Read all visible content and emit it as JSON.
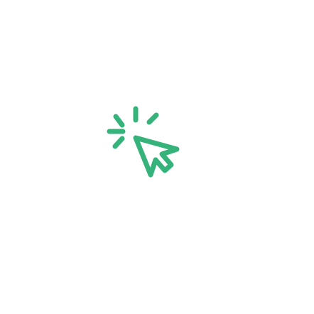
{
  "icon": {
    "name": "click-cursor-icon",
    "color": "#35b37a",
    "background": "#ffffff"
  }
}
